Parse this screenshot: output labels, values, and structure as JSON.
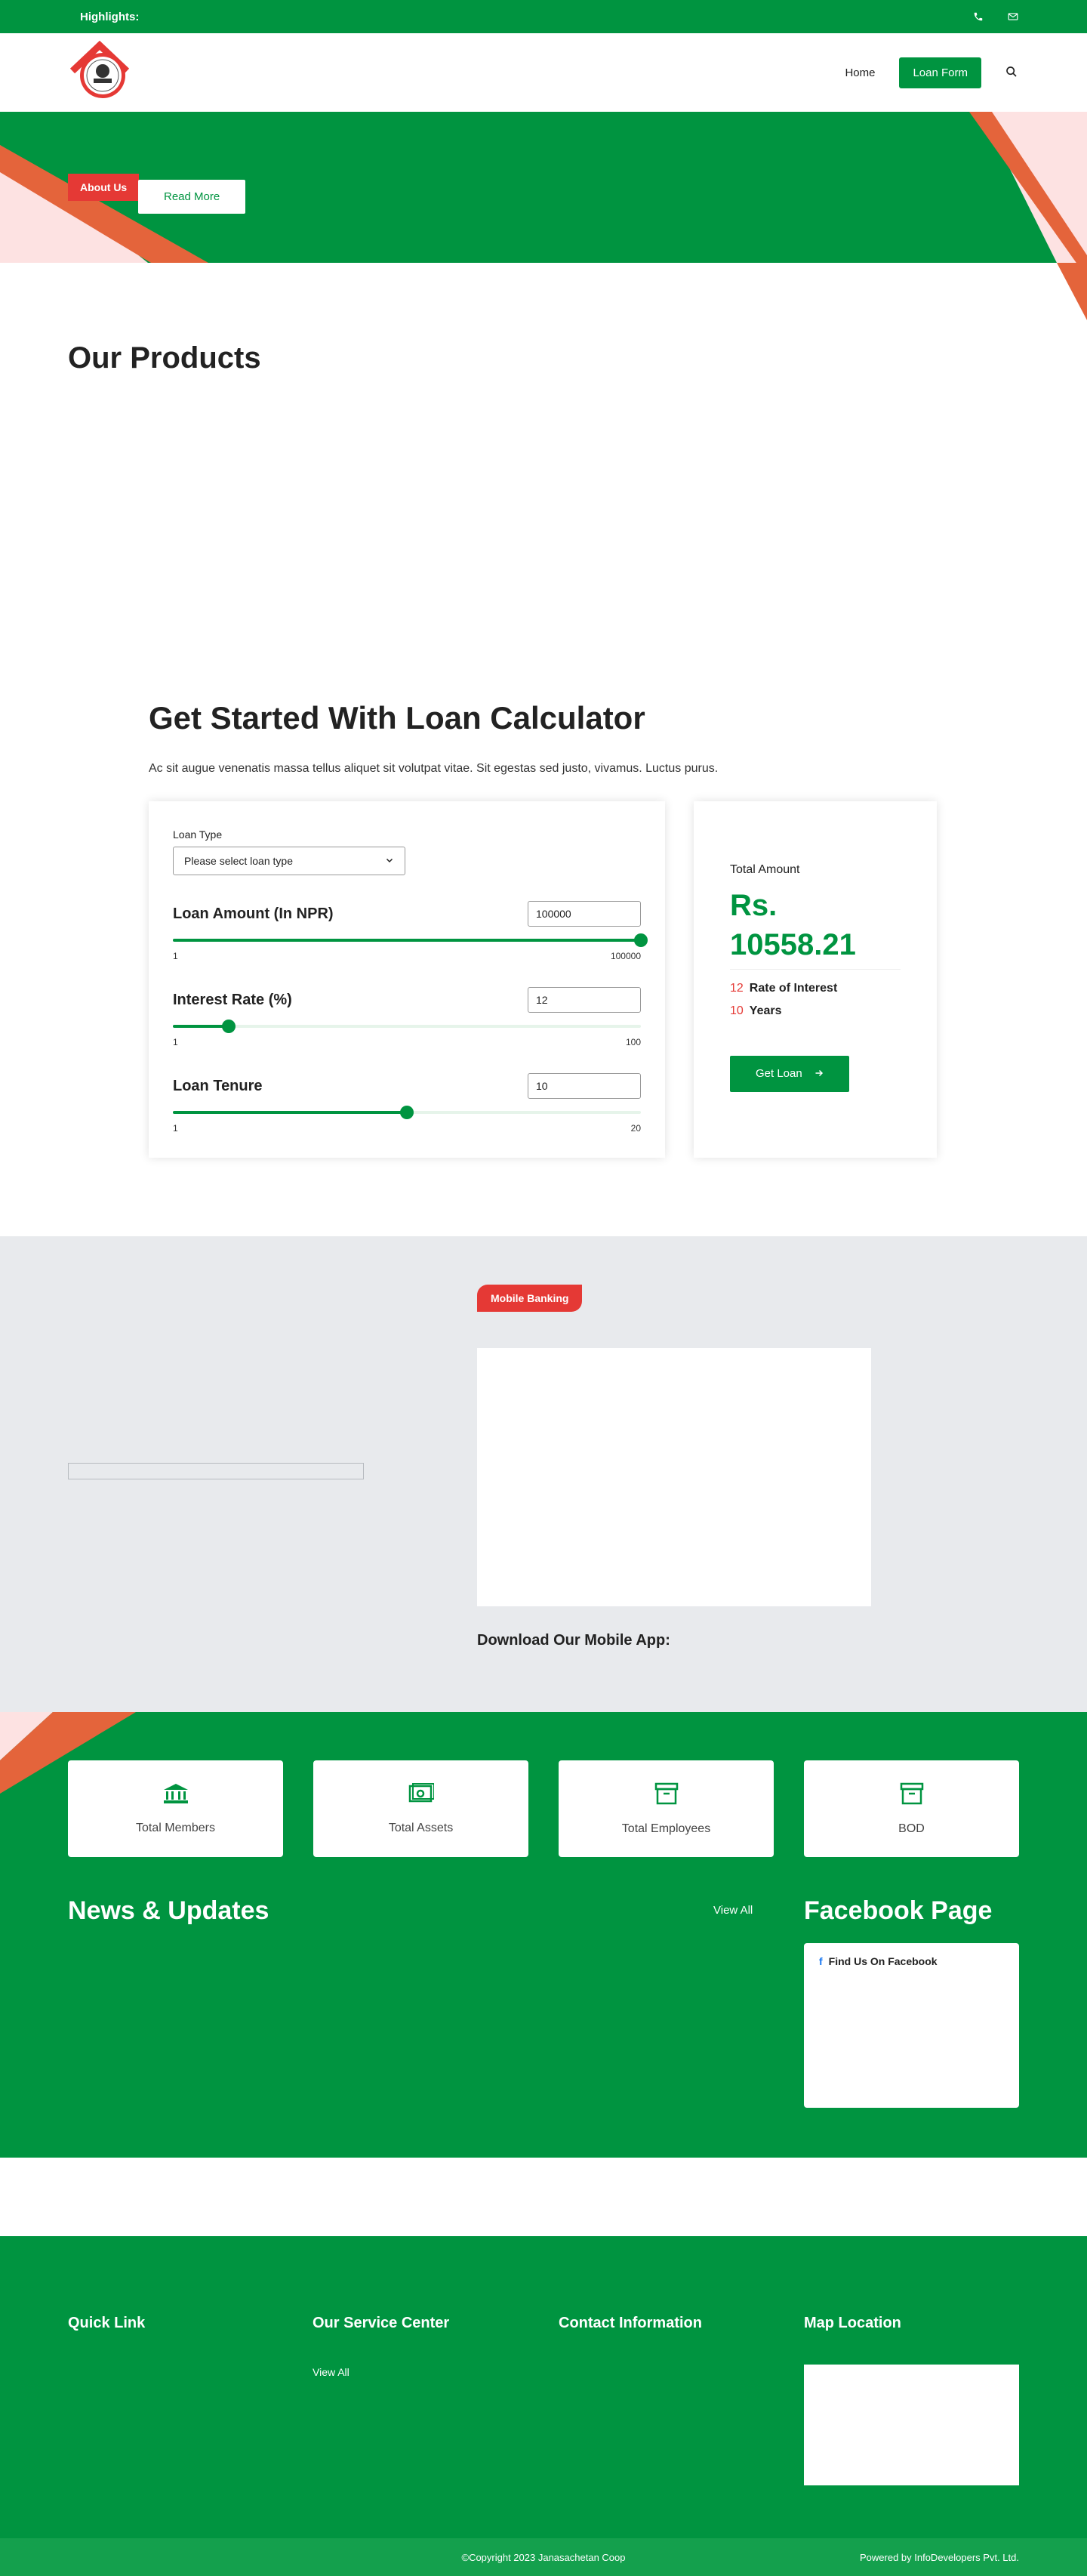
{
  "topbar": {
    "highlights": "Highlights:"
  },
  "nav": {
    "home": "Home",
    "loan_form": "Loan Form"
  },
  "hero": {
    "about": "About Us",
    "read_more": "Read More"
  },
  "products": {
    "title": "Our Products"
  },
  "calculator": {
    "title": "Get Started With Loan Calculator",
    "desc": "Ac sit augue venenatis massa tellus aliquet sit volutpat vitae. Sit egestas sed justo, vivamus. Luctus purus.",
    "loan_type_label": "Loan Type",
    "loan_type_placeholder": "Please select loan type",
    "amount": {
      "label": "Loan Amount (In NPR)",
      "value": "100000",
      "min": "1",
      "max": "100000",
      "level": 1.0
    },
    "interest": {
      "label": "Interest Rate (%)",
      "value": "12",
      "min": "1",
      "max": "100",
      "level": 0.12
    },
    "tenure": {
      "label": "Loan Tenure",
      "value": "10",
      "min": "1",
      "max": "20",
      "level": 0.5
    },
    "total_label": "Total Amount",
    "total_value": "Rs. 10558.21",
    "rate_num": "12",
    "rate_label": "Rate of Interest",
    "years_num": "10",
    "years_label": "Years",
    "get_loan": "Get Loan"
  },
  "mobile": {
    "badge": "Mobile Banking",
    "download": "Download Our Mobile App:"
  },
  "stats": [
    {
      "label": "Total Members",
      "icon": "bank-icon"
    },
    {
      "label": "Total Assets",
      "icon": "money-icon"
    },
    {
      "label": "Total Employees",
      "icon": "archive-icon"
    },
    {
      "label": "BOD",
      "icon": "archive-icon"
    }
  ],
  "news": {
    "title": "News & Updates",
    "view_all": "View All"
  },
  "facebook": {
    "title": "Facebook Page",
    "find": "Find Us On Facebook"
  },
  "footer": {
    "quick_link": "Quick Link",
    "service_center": "Our Service Center",
    "view_all": "View All",
    "contact": "Contact Information",
    "map": "Map Location",
    "copyright": "©Copyright 2023 Janasachetan Coop",
    "powered": "Powered by InfoDevelopers Pvt. Ltd."
  },
  "colors": {
    "green": "#009440",
    "red": "#e53935",
    "orange": "#e4643b",
    "pink": "#fde2e2"
  }
}
